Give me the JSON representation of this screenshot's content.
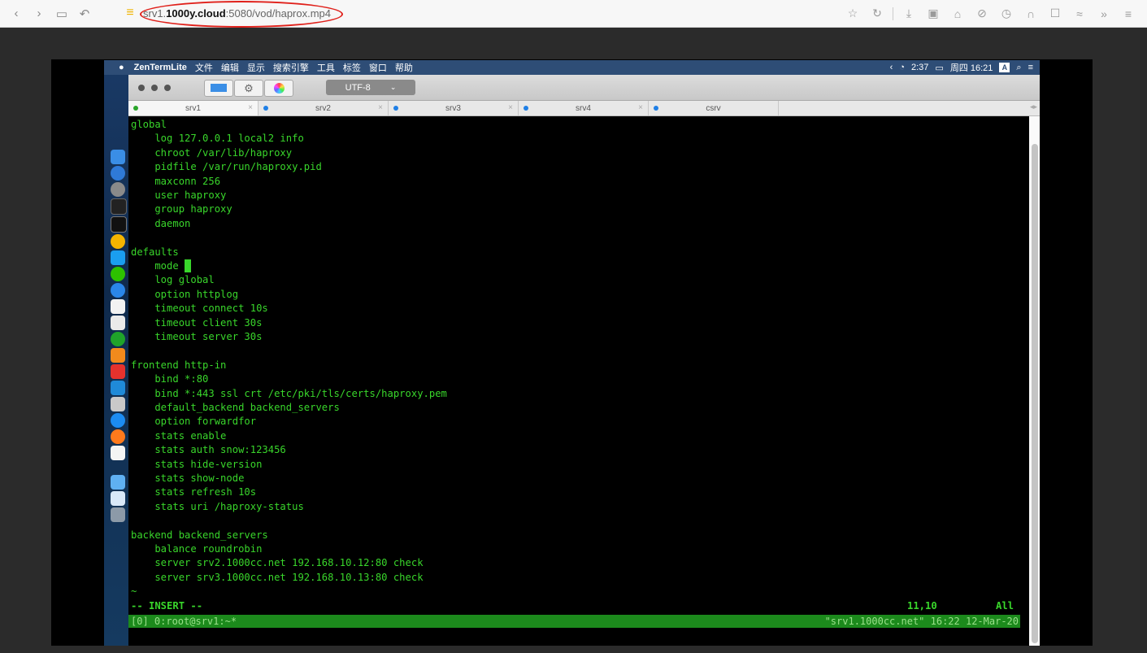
{
  "browser": {
    "url_prefix": "srv1.",
    "url_domain": "1000y.cloud",
    "url_suffix": ":5080/vod/haprox.mp4"
  },
  "mac": {
    "menubar": {
      "app_name": "ZenTermLite",
      "items": [
        "文件",
        "编辑",
        "显示",
        "搜索引擎",
        "工具",
        "标签",
        "窗口",
        "帮助"
      ],
      "battery_time": "2:37",
      "clock": "周四 16:21",
      "input_badge": "A"
    }
  },
  "terminal": {
    "encoding": "UTF-8",
    "tabs": [
      {
        "label": "srv1",
        "dot": "#2aa52a"
      },
      {
        "label": "srv2",
        "dot": "#1f7fe6"
      },
      {
        "label": "srv3",
        "dot": "#1f7fe6"
      },
      {
        "label": "srv4",
        "dot": "#1f7fe6"
      },
      {
        "label": "csrv",
        "dot": "#1f7fe6"
      }
    ],
    "lines": [
      "global",
      "    log 127.0.0.1 local2 info",
      "    chroot /var/lib/haproxy",
      "    pidfile /var/run/haproxy.pid",
      "    maxconn 256",
      "    user haproxy",
      "    group haproxy",
      "    daemon",
      "",
      "defaults",
      "    mode ",
      "    log global",
      "    option httplog",
      "    timeout connect 10s",
      "    timeout client 30s",
      "    timeout server 30s",
      "",
      "frontend http-in",
      "    bind *:80",
      "    bind *:443 ssl crt /etc/pki/tls/certs/haproxy.pem",
      "    default_backend backend_servers",
      "    option forwardfor",
      "    stats enable",
      "    stats auth snow:123456",
      "    stats hide-version",
      "    stats show-node",
      "    stats refresh 10s",
      "    stats uri /haproxy-status",
      "",
      "backend backend_servers",
      "    balance roundrobin",
      "    server srv2.1000cc.net 192.168.10.12:80 check",
      "    server srv3.1000cc.net 192.168.10.13:80 check",
      "~"
    ],
    "cursor_line": 10,
    "status": {
      "mode": "-- INSERT --",
      "position": "11,10",
      "scroll": "All"
    },
    "tmux": {
      "left": "[0] 0:root@srv1:~*",
      "right": "\"srv1.1000cc.net\" 16:22 12-Mar-20"
    }
  }
}
